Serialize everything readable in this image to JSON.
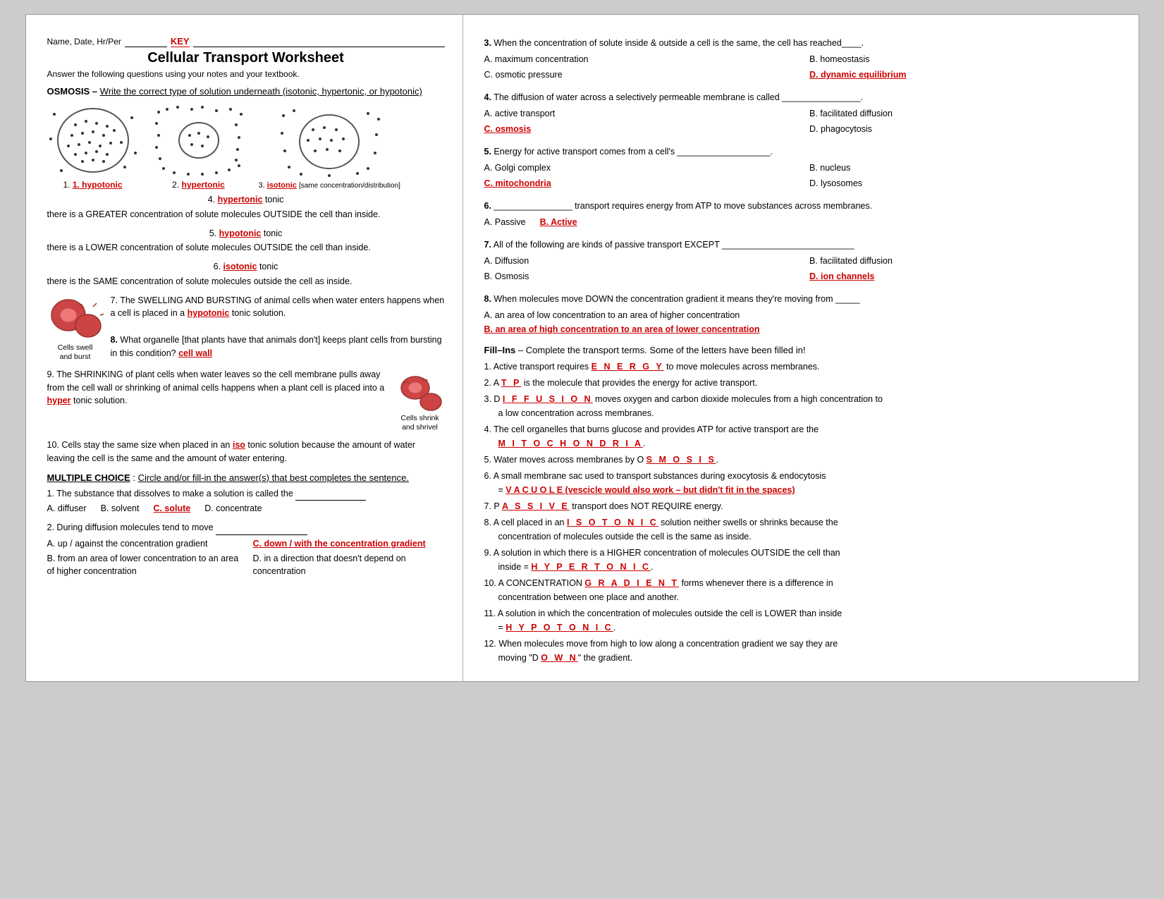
{
  "header": {
    "name_label": "Name, Date, Hr/Per",
    "key": "KEY",
    "title": "Cellular Transport Worksheet",
    "subtitle": "Answer the following questions using your notes and your textbook."
  },
  "left": {
    "osmosis_header": "OSMOSIS –",
    "osmosis_instruction": "Write the correct type of solution underneath (isotonic, hypertonic, or hypotonic)",
    "diagram_labels": [
      "1. hypotonic",
      "2. hypertonic",
      "3. isotonic [same concentration/distribution]"
    ],
    "q4": {
      "num": "4.",
      "answer": "hypertonic",
      "text": "tonic",
      "detail": "there is a GREATER concentration of solute molecules OUTSIDE the cell than inside."
    },
    "q5": {
      "num": "5.",
      "answer": "hypotonic",
      "text": "tonic",
      "detail": "there is a LOWER concentration of solute molecules OUTSIDE the cell than inside."
    },
    "q6": {
      "num": "6.",
      "answer": "isotonic",
      "text": "tonic",
      "detail": "there is the SAME concentration of solute molecules outside the cell as inside."
    },
    "q7": {
      "num": "7.",
      "text": "The SWELLING AND BURSTING of animal cells when water enters happens when a cell is placed in a",
      "answer": "hypotonic",
      "text2": "tonic solution."
    },
    "cells_swell_label": "Cells swell\nand burst",
    "q8": {
      "num": "8.",
      "text": "What organelle [that plants have that animals don't] keeps plant cells from bursting in this condition?",
      "answer": "cell wall"
    },
    "q9": {
      "num": "9.",
      "text1": "The SHRINKING of plant cells when water leaves so the cell membrane pulls away from the cell wall or shrinking of animal cells happens when a plant cell is placed into a",
      "answer": "hyper",
      "text2": "tonic solution."
    },
    "cells_shrink_label": "Cells shrink\nand shrivel",
    "q10": {
      "num": "10.",
      "text1": "Cells stay the same size when placed in an",
      "answer": "iso",
      "text2": "tonic solution because the amount of water leaving the cell is the same and the amount of water entering."
    },
    "mc_header": "MULTIPLE CHOICE",
    "mc_instruction": "Circle and/or fill-in the answer(s) that best completes the sentence.",
    "mc1": {
      "num": "1.",
      "text": "The substance that dissolves to make a solution is called the",
      "answer_line": true,
      "options": [
        {
          "letter": "A.",
          "text": "diffuser"
        },
        {
          "letter": "B.",
          "text": "solvent"
        },
        {
          "letter": "C.",
          "text": "solute",
          "correct": true
        },
        {
          "letter": "D.",
          "text": "concentrate"
        }
      ]
    },
    "mc2": {
      "num": "2.",
      "text": "During diffusion molecules tend to move",
      "answer_line": true,
      "options_2col": [
        {
          "letter": "A.",
          "text": "up / against the concentration gradient"
        },
        {
          "letter": "C.",
          "text": "down / with the concentration gradient",
          "correct": true
        },
        {
          "letter": "B.",
          "text": "from an area of lower concentration to an area of higher concentration"
        },
        {
          "letter": "D.",
          "text": "in a direction that doesn't depend on concentration"
        }
      ]
    }
  },
  "right": {
    "q3": {
      "num": "3.",
      "text": "When the concentration of solute inside & outside a cell is the same, the cell has reached____.",
      "options": [
        {
          "letter": "A.",
          "text": "maximum concentration"
        },
        {
          "letter": "B.",
          "text": "homeostasis"
        },
        {
          "letter": "C.",
          "text": "osmotic pressure"
        },
        {
          "letter": "D.",
          "text": "dynamic equilibrium",
          "correct": true
        }
      ]
    },
    "q4": {
      "num": "4.",
      "text": "The diffusion of water across a selectively permeable membrane is called ________________.",
      "options": [
        {
          "letter": "A.",
          "text": "active transport"
        },
        {
          "letter": "B.",
          "text": "facilitated diffusion"
        },
        {
          "letter": "C.",
          "text": "osmosis",
          "correct": true
        },
        {
          "letter": "D.",
          "text": "phagocytosis"
        }
      ]
    },
    "q5": {
      "num": "5.",
      "text": "Energy for active transport comes from a cell's ___________________.",
      "options": [
        {
          "letter": "A.",
          "text": "Golgi complex"
        },
        {
          "letter": "B.",
          "text": "nucleus"
        },
        {
          "letter": "C.",
          "text": "mitochondria",
          "correct": true
        },
        {
          "letter": "D.",
          "text": "lysosomes"
        }
      ]
    },
    "q6": {
      "num": "6.",
      "text": "________________ transport requires energy from ATP to move substances across membranes.",
      "options": [
        {
          "letter": "A.",
          "text": "Passive"
        },
        {
          "letter": "B.",
          "text": "Active",
          "correct": true
        }
      ]
    },
    "q7": {
      "num": "7.",
      "text": "All of the following are kinds of passive transport EXCEPT ___________________________",
      "options": [
        {
          "letter": "A.",
          "text": "Diffusion"
        },
        {
          "letter": "B.",
          "text": "facilitated diffusion"
        },
        {
          "letter": "B.",
          "text": "Osmosis"
        },
        {
          "letter": "D.",
          "text": "ion channels",
          "correct": true
        }
      ]
    },
    "q8": {
      "num": "8.",
      "text": "When molecules move DOWN the concentration gradient it means they're moving from _____",
      "options": [
        {
          "letter": "A.",
          "text": "an area of low concentration to an area of higher concentration"
        },
        {
          "letter": "B.",
          "text": "an area of high concentration to an area of lower concentration",
          "correct": true
        }
      ]
    },
    "fill_ins_header": "Fill–Ins",
    "fill_ins_instruction": "– Complete the transport terms. Some of the letters have been filled in!",
    "fill_items": [
      {
        "num": "1.",
        "text1": "Active transport requires ",
        "answer": "E N E R G Y",
        "text2": " to move molecules across membranes."
      },
      {
        "num": "2.",
        "text1": "A ",
        "answer": "T P",
        "text2": " is the molecule that provides the energy for active transport."
      },
      {
        "num": "3.",
        "text1": "D ",
        "answer": "I F F U S I O N",
        "text2": " moves oxygen and carbon dioxide molecules from a high concentration to a low concentration across membranes."
      },
      {
        "num": "4.",
        "text1": "The cell organelles that burns glucose and provides ATP for active transport are the ",
        "answer": "M I T O C H O N D R I A",
        "text2": "."
      },
      {
        "num": "5.",
        "text1": "Water moves across membranes by O ",
        "answer": "S M O S I S",
        "text2": "."
      },
      {
        "num": "6.",
        "text1": "A small membrane sac used to transport substances during exocytosis & endocytosis = ",
        "answer": "V A C U O L E (vescicle would also work – but didn't fit in the spaces)",
        "text2": ""
      },
      {
        "num": "7.",
        "text1": "P ",
        "answer": "A S S I V E",
        "text2": " transport does NOT REQUIRE energy."
      },
      {
        "num": "8.",
        "text1": "A cell placed in an  ",
        "answer": "I S O T O N I C",
        "text2": " solution neither swells or shrinks because the concentration of molecules outside the cell is the same as inside."
      },
      {
        "num": "9.",
        "text1": "A solution in which there is a HIGHER concentration of molecules OUTSIDE the cell than inside = ",
        "answer": "H Y P E R T O N I C",
        "text2": "."
      },
      {
        "num": "10.",
        "text1": "A CONCENTRATION  ",
        "answer": "G R A D I E N T",
        "text2": " forms whenever there is a difference in concentration between one place and another."
      },
      {
        "num": "11.",
        "text1": "A solution in which the concentration of molecules outside the cell is LOWER than inside = ",
        "answer": "H Y P O T O N I C",
        "text2": "."
      },
      {
        "num": "12.",
        "text1": "When molecules move from high to low along a concentration gradient we say they are moving \"D ",
        "answer": "O W N",
        "text2": "\" the gradient."
      }
    ]
  }
}
